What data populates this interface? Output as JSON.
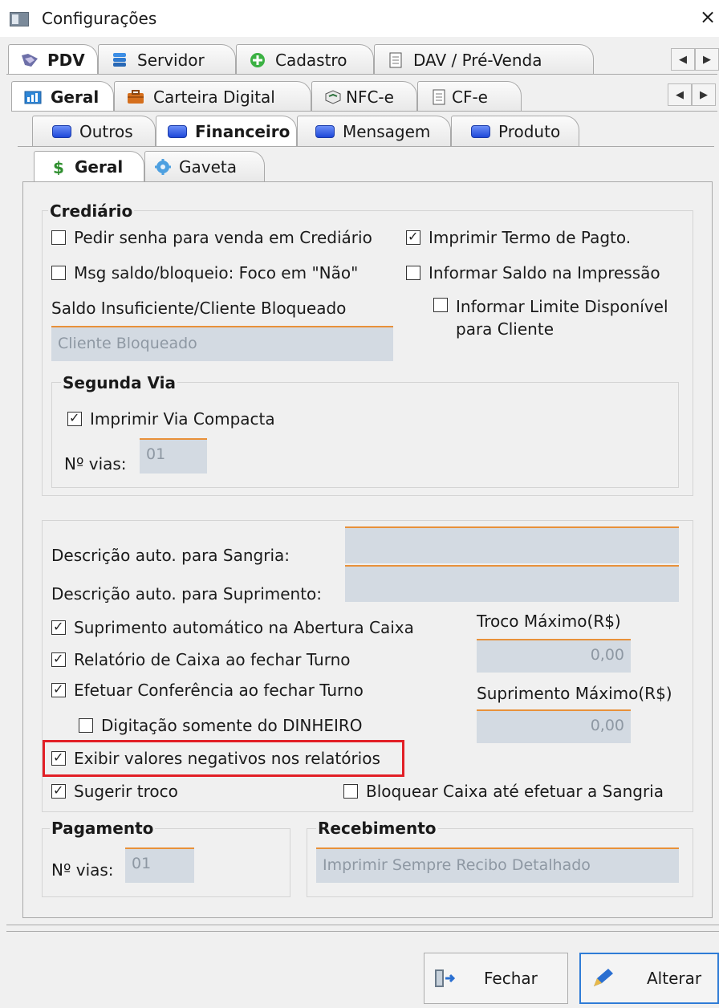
{
  "window": {
    "title": "Configurações",
    "close_glyph": "×"
  },
  "tabs_row1": [
    {
      "label": "PDV",
      "icon": "pdv-icon",
      "active": true
    },
    {
      "label": "Servidor",
      "icon": "database-icon"
    },
    {
      "label": "Cadastro",
      "icon": "plus-green-icon"
    },
    {
      "label": "DAV / Pré-Venda",
      "icon": "document-icon"
    }
  ],
  "tabs_row2": [
    {
      "label": "Geral",
      "icon": "geral-icon",
      "active": true
    },
    {
      "label": "Carteira Digital",
      "icon": "wallet-icon"
    },
    {
      "label": "NFC-e",
      "icon": "nfce-icon"
    },
    {
      "label": "CF-e",
      "icon": "document-icon"
    }
  ],
  "tabs_row3": [
    {
      "label": "Outros"
    },
    {
      "label": "Financeiro",
      "active": true
    },
    {
      "label": "Mensagem"
    },
    {
      "label": "Produto"
    }
  ],
  "tabs_row4": [
    {
      "label": "Geral",
      "icon": "dollar-icon",
      "active": true
    },
    {
      "label": "Gaveta",
      "icon": "gear-icon"
    }
  ],
  "crediario": {
    "legend": "Crediário",
    "pedir_senha": {
      "label": "Pedir senha para venda em Crediário",
      "checked": false
    },
    "imprimir_termo": {
      "label": "Imprimir Termo de Pagto.",
      "checked": true
    },
    "msg_saldo": {
      "label": "Msg saldo/bloqueio: Foco em \"Não\"",
      "checked": false
    },
    "informar_saldo": {
      "label": "Informar Saldo na Impressão",
      "checked": false
    },
    "saldo_label": "Saldo Insuficiente/Cliente Bloqueado",
    "informar_limite_line1": "Informar Limite Disponível",
    "informar_limite_line2": "para Cliente",
    "informar_limite_checked": false,
    "saldo_value": "Cliente Bloqueado"
  },
  "segunda_via": {
    "legend": "Segunda Via",
    "imprimir_compacta": {
      "label": "Imprimir Via Compacta",
      "checked": true
    },
    "vias_label": "Nº vias:",
    "vias_value": "01"
  },
  "caixa": {
    "desc_sangria_label": "Descrição auto. para Sangria:",
    "desc_suprimento_label": "Descrição auto. para Suprimento:",
    "suprimento_auto": {
      "label": "Suprimento automático na Abertura Caixa",
      "checked": true
    },
    "relatorio_caixa": {
      "label": "Relatório de Caixa ao fechar Turno",
      "checked": true
    },
    "efetuar_conferencia": {
      "label": "Efetuar Conferência ao fechar Turno",
      "checked": true
    },
    "digitacao_dinheiro": {
      "label": "Digitação somente do DINHEIRO",
      "checked": false
    },
    "exibir_negativos": {
      "label": "Exibir valores negativos nos relatórios",
      "checked": true
    },
    "sugerir_troco": {
      "label": "Sugerir troco",
      "checked": true
    },
    "bloquear_caixa": {
      "label": "Bloquear Caixa até efetuar a Sangria",
      "checked": false
    },
    "troco_max_label": "Troco Máximo(R$)",
    "troco_max_value": "0,00",
    "suprimento_max_label": "Suprimento Máximo(R$)",
    "suprimento_max_value": "0,00"
  },
  "pagamento": {
    "legend": "Pagamento",
    "vias_label": "Nº vias:",
    "vias_value": "01"
  },
  "recebimento": {
    "legend": "Recebimento",
    "value": "Imprimir Sempre Recibo Detalhado"
  },
  "buttons": {
    "fechar": "Fechar",
    "alterar": "Alterar"
  },
  "colors": {
    "highlight": "#e21f26",
    "field_bg": "#d3dae2",
    "field_accent": "#e8913a",
    "primary_border": "#2f7cd6"
  }
}
